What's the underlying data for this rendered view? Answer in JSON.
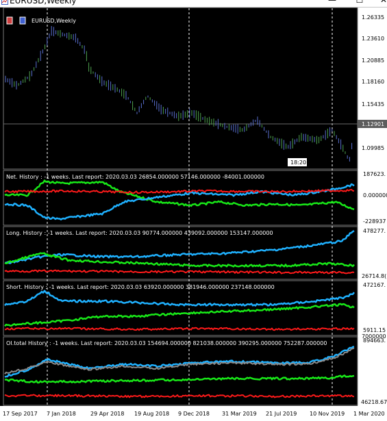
{
  "window": {
    "title": "EURUSD,Weekly",
    "minimize": "—",
    "maximize": "☐",
    "close": "✕"
  },
  "main_chart": {
    "symbol_label": "EURUSD,Weekly",
    "price_axis": [
      "1.26335",
      "1.23610",
      "1.20885",
      "1.18160",
      "1.15435",
      "1.12901",
      "1.09985"
    ],
    "current_price": "1.12901",
    "time_label": "18:20"
  },
  "panels": [
    {
      "id": "net",
      "label": "Net. History : -1 weeks. Last report: 2020.03.03     26854.000000  57146.000000  -84001.000000",
      "axis_top": "187623.",
      "axis_mid": "0.000000",
      "axis_bottom": "-228937"
    },
    {
      "id": "long",
      "label": "Long. History : -1 weeks. Last report: 2020.03.03     90774.000000  439092.000000  153147.000000",
      "axis_top": "478277.",
      "axis_bottom": "26714.8("
    },
    {
      "id": "short",
      "label": "Short. History : -1 weeks. Last report: 2020.03.03     63920.000000  381946.000000  237148.000000",
      "axis_top": "472167.",
      "axis_bottom": "5911.15",
      "axis_bottom2": "7000000"
    },
    {
      "id": "oi",
      "label": "OI.total History : -1 weeks. Last report: 2020.03.03     154694.000000  821038.000000  390295.000000  752287.000000",
      "axis_top": "894663.",
      "axis_bottom": "46218.67"
    }
  ],
  "time_axis": [
    "17 Sep 2017",
    "7 Jan 2018",
    "29 Apr 2018",
    "19 Aug 2018",
    "9 Dec 2018",
    "31 Mar 2019",
    "21 Jul 2019",
    "10 Nov 2019",
    "1 Mar 2020"
  ],
  "colors": {
    "background": "#000000",
    "candle_up": "#4fa34f",
    "candle_down": "#5a6fd0",
    "blue_line": "#1fb1ff",
    "green_line": "#18e818",
    "red_line": "#ff1a1a",
    "gray_line": "#8a8a8a"
  }
}
